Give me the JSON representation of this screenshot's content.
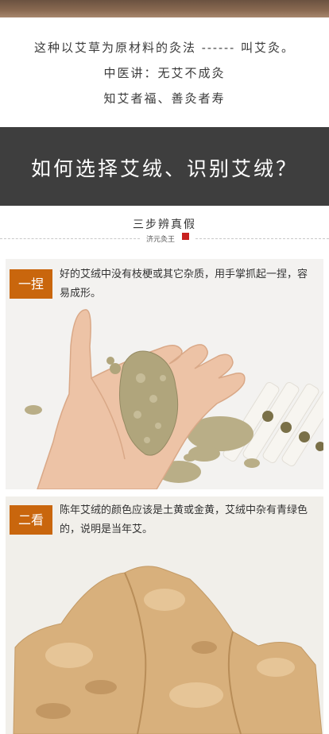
{
  "intro": {
    "line1": "这种以艾草为原材料的灸法 ------ 叫艾灸。",
    "line2": "中医讲：无艾不成灸",
    "line3": "知艾者福、善灸者寿"
  },
  "banner": {
    "title": "如何选择艾绒、识别艾绒？"
  },
  "steps_section": {
    "title": "三步辨真假",
    "brand": "济元灸王"
  },
  "steps": [
    {
      "tag": "一捏",
      "text": "好的艾绒中没有枝梗或其它杂质，用手掌抓起一捏，容易成形。"
    },
    {
      "tag": "二看",
      "text": "陈年艾绒的颜色应该是土黄或金黄，艾绒中杂有青绿色的，说明是当年艾。"
    }
  ],
  "colors": {
    "banner_bg": "#3e3e3e",
    "tag_bg": "#c9660d",
    "seal": "#c8211f"
  }
}
